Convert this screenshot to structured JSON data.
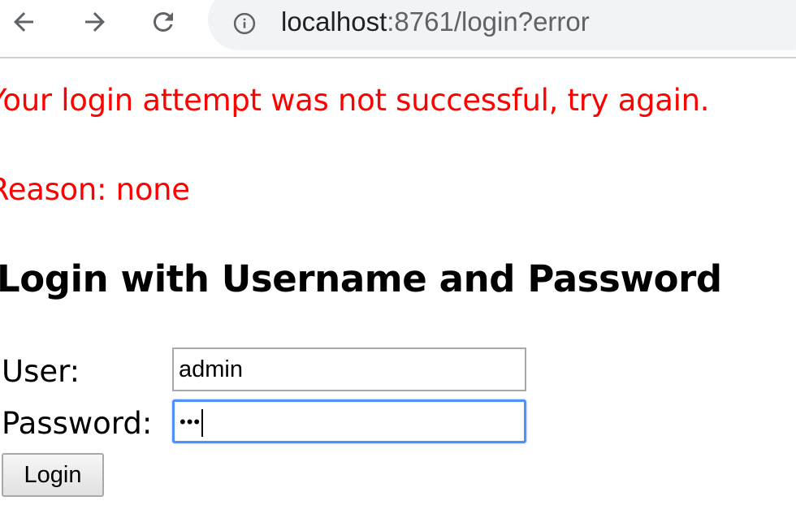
{
  "browser": {
    "back_icon": "arrow-left-icon",
    "forward_icon": "arrow-right-icon",
    "reload_icon": "reload-icon",
    "security_icon": "info-icon",
    "url_host": "localhost",
    "url_rest": ":8761/login?error"
  },
  "page": {
    "error_message": "Your login attempt was not successful, try again.",
    "error_reason": "Reason: none",
    "error_color": "#ff0000",
    "heading": "Login with Username and Password",
    "form": {
      "user_label": "User:",
      "user_value": "admin",
      "password_label": "Password:",
      "password_masked": "•••",
      "submit_label": "Login"
    }
  }
}
